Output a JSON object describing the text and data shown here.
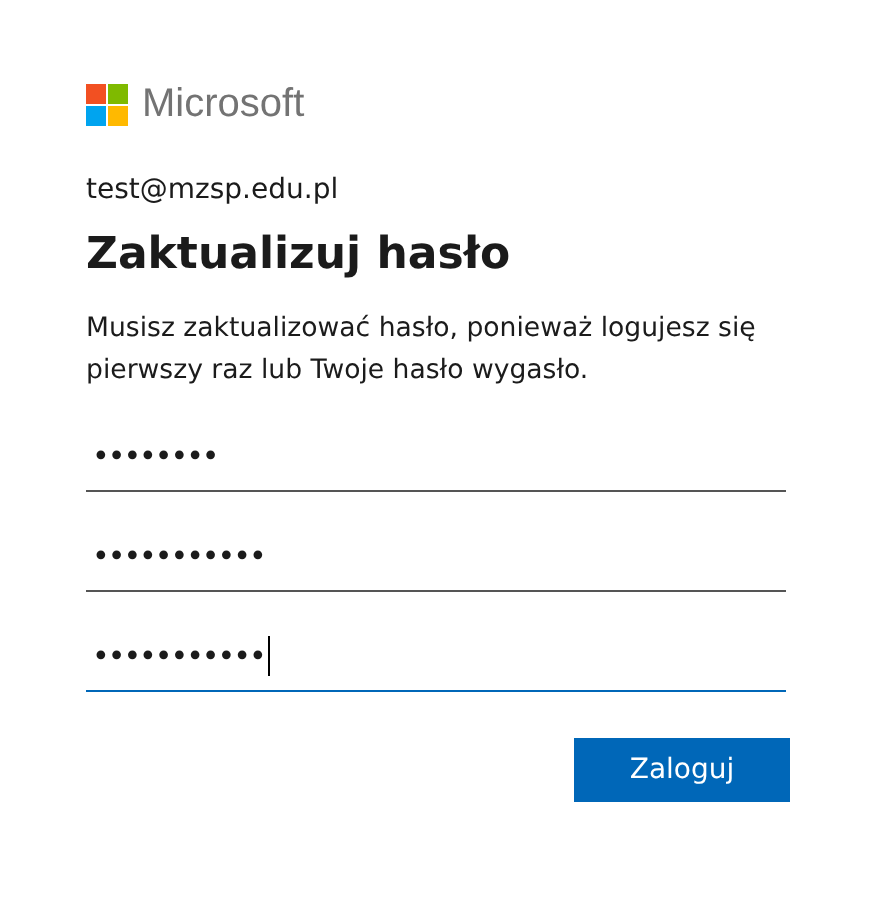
{
  "brand": "Microsoft",
  "account": "test@mzsp.edu.pl",
  "title": "Zaktualizuj hasło",
  "description": "Musisz zaktualizować hasło, ponieważ logujesz się pierwszy raz lub Twoje hasło wygasło.",
  "fields": [
    {
      "value": "••••••••",
      "focused": false
    },
    {
      "value": "•••••••••••",
      "focused": false
    },
    {
      "value": "•••••••••••",
      "focused": true
    }
  ],
  "submit": "Zaloguj"
}
